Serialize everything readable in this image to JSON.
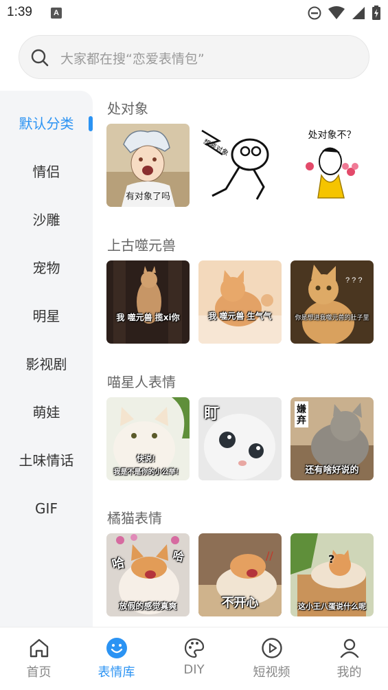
{
  "status_bar": {
    "time": "1:39",
    "notif_letter": "A"
  },
  "search": {
    "placeholder": "大家都在搜“恋爱表情包”"
  },
  "sidebar": {
    "items": [
      {
        "label": "默认分类",
        "active": true
      },
      {
        "label": "情侣"
      },
      {
        "label": "沙雕"
      },
      {
        "label": "宠物"
      },
      {
        "label": "明星"
      },
      {
        "label": "影视剧"
      },
      {
        "label": "萌娃"
      },
      {
        "label": "土味情话"
      },
      {
        "label": "GIF"
      }
    ]
  },
  "sections": [
    {
      "title": "处对象",
      "tiles": [
        {
          "caption": "有对象了吗"
        },
        {
          "caption": "想要对象"
        },
        {
          "caption": "处对象不？"
        }
      ]
    },
    {
      "title": "上古噬元兽",
      "tiles": [
        {
          "caption": "我 噬元兽 揽xi你"
        },
        {
          "caption": "我 噬元兽 生气气"
        },
        {
          "caption": "你是想进我噬元兽的肚子里"
        }
      ]
    },
    {
      "title": "喵星人表情",
      "tiles": [
        {
          "caption_line1": "快说！",
          "caption_line2": "我是不是你的小公举！"
        },
        {
          "caption": "盯"
        },
        {
          "caption_side": "嫌弃",
          "caption": "还有啥好说的"
        }
      ]
    },
    {
      "title": "橘猫表情",
      "tiles": [
        {
          "caption_left": "哈",
          "caption_right": "哈",
          "caption": "放假的感觉真爽"
        },
        {
          "caption": "不开心"
        },
        {
          "caption_mark": "?",
          "caption": "这小王八蛋说什么呢"
        }
      ]
    }
  ],
  "bottom_nav": {
    "items": [
      {
        "label": "首页",
        "icon": "home-icon"
      },
      {
        "label": "表情库",
        "icon": "smile-icon",
        "active": true
      },
      {
        "label": "DIY",
        "icon": "palette-icon"
      },
      {
        "label": "短视频",
        "icon": "play-icon"
      },
      {
        "label": "我的",
        "icon": "user-icon"
      }
    ]
  },
  "colors": {
    "accent": "#2b93f3",
    "sidebar_bg": "#f4f5f7",
    "text": "#333333",
    "muted": "#888888"
  }
}
